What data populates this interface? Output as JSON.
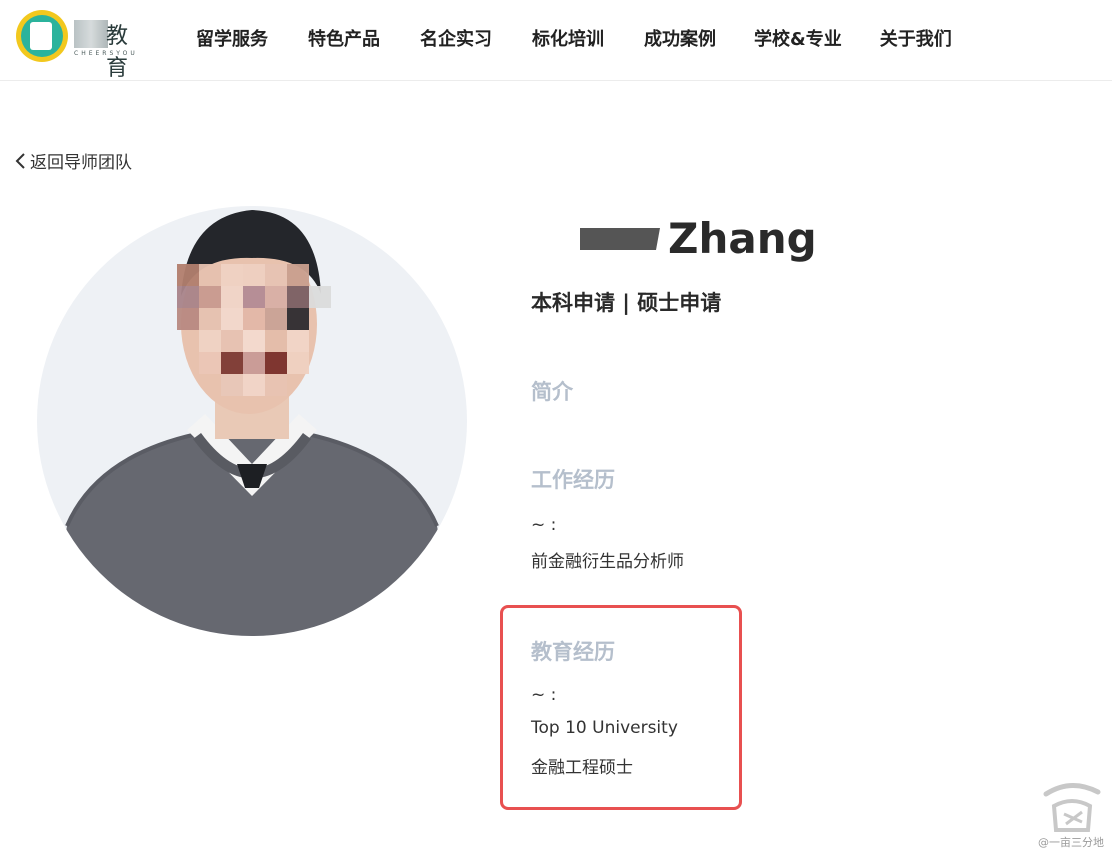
{
  "header": {
    "logo": {
      "brand": "教育",
      "tagline": "CHEERSYOU"
    },
    "nav": [
      "留学服务",
      "特色产品",
      "名企实习",
      "标化培训",
      "成功案例",
      "学校&专业",
      "关于我们"
    ]
  },
  "back_link": "返回导师团队",
  "profile": {
    "name": "Zhang",
    "roles": "本科申请 | 硕士申请",
    "intro_title": "简介",
    "work_title": "工作经历",
    "work_period": "~ :",
    "work_role": "前金融衍生品分析师",
    "edu_title": "教育经历",
    "edu_period": "~ :",
    "edu_school": "Top 10 University",
    "edu_degree": "金融工程硕士"
  },
  "watermark": "@一亩三分地",
  "colors": {
    "section_title": "#b5bfcc",
    "highlight_border": "#e85050",
    "avatar_bg": "#eef1f5"
  }
}
